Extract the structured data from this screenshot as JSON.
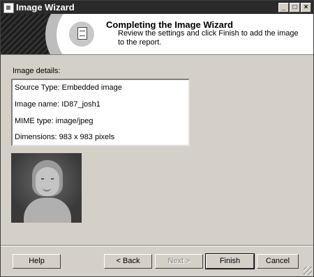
{
  "window": {
    "title": "Image Wizard"
  },
  "titlebar_buttons": {
    "minimize": "_",
    "maximize": "□",
    "close": "×"
  },
  "header": {
    "title": "Completing the Image Wizard",
    "subtitle": "Review the settings and click Finish to add the image to the report."
  },
  "details": {
    "label": "Image details:",
    "lines": [
      "Source Type: Embedded image",
      "Image name: ID87_josh1",
      "MIME type: image/jpeg",
      "Dimensions: 983 x 983 pixels"
    ]
  },
  "preview": {
    "icon": "image-preview"
  },
  "buttons": {
    "help": "Help",
    "back": "< Back",
    "next": "Next >",
    "finish": "Finish",
    "cancel": "Cancel"
  }
}
